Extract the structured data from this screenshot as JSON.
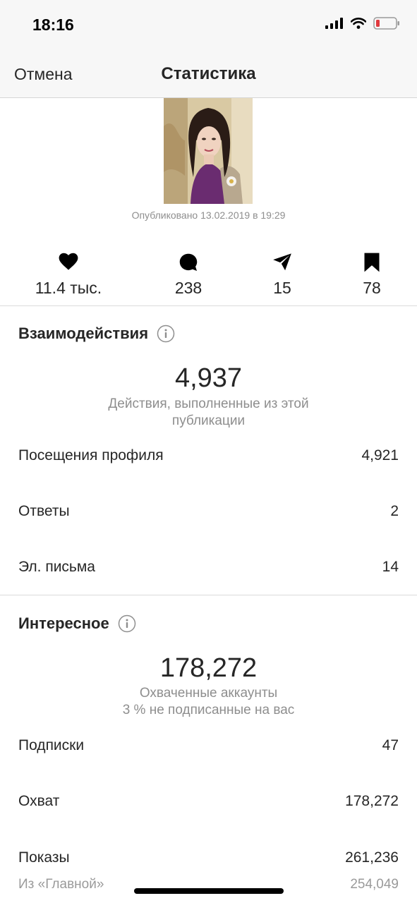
{
  "status_bar": {
    "time": "18:16"
  },
  "nav": {
    "cancel_label": "Отмена",
    "title": "Статистика"
  },
  "post": {
    "published": "Опубликовано 13.02.2019 в 19:29"
  },
  "counters": [
    {
      "icon": "heart-icon",
      "value": "11.4 тыс."
    },
    {
      "icon": "comment-icon",
      "value": "238"
    },
    {
      "icon": "send-icon",
      "value": "15"
    },
    {
      "icon": "bookmark-icon",
      "value": "78"
    }
  ],
  "interactions": {
    "title": "Взаимодействия",
    "total": "4,937",
    "desc_line1": "Действия, выполненные из этой",
    "desc_line2": "публикации",
    "rows": [
      {
        "label": "Посещения профиля",
        "value": "4,921"
      },
      {
        "label": "Ответы",
        "value": "2"
      },
      {
        "label": "Эл. письма",
        "value": "14"
      }
    ]
  },
  "discovery": {
    "title": "Интересное",
    "total": "178,272",
    "desc_line1": "Охваченные аккаунты",
    "desc_line2": "3 % не подписанные на вас",
    "rows": [
      {
        "label": "Подписки",
        "value": "47"
      },
      {
        "label": "Охват",
        "value": "178,272"
      },
      {
        "label": "Показы",
        "value": "261,236"
      },
      {
        "label": "Из «Главной»",
        "value": "254,049"
      }
    ]
  },
  "colors": {
    "text": "#262626",
    "muted": "#8e8e8e",
    "battery_low": "#e0393e",
    "navbar_bg": "#f7f7f7"
  }
}
